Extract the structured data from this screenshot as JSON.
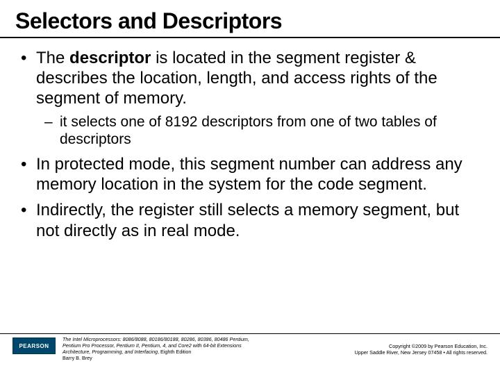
{
  "title": "Selectors and Descriptors",
  "bullets": {
    "b1_pre": "The ",
    "b1_bold": "descriptor",
    "b1_post": " is located in the segment register & describes the location, length, and access rights of the segment of memory.",
    "s1": "it selects one of 8192 descriptors from one of two tables of descriptors",
    "b2": "In protected mode, this segment number can address any memory location in the system for the code segment.",
    "b3": "Indirectly, the register still selects a memory segment, but not directly as in real mode."
  },
  "footer": {
    "publisher": "PEARSON",
    "book_line1": "The Intel Microprocessors: 8086/8088, 80186/80188, 80286, 80386, 80486 Pentium,",
    "book_line2": "Pentium Pro Processor, Pentium II, Pentium, 4, and Core2 with 64-bit Extensions",
    "book_line3": "Architecture, Programming, and Interfacing",
    "book_line3_tail": ", Eighth Edition",
    "book_line4": "Barry B. Brey",
    "copy_line1": "Copyright ©2009 by Pearson Education, Inc.",
    "copy_line2": "Upper Saddle River, New Jersey 07458 • All rights reserved."
  }
}
